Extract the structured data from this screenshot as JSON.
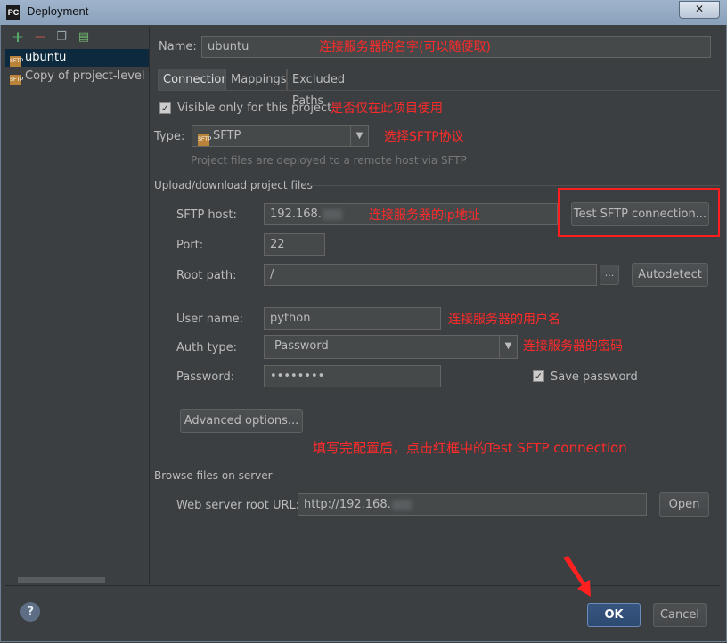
{
  "window": {
    "app_icon": "PC",
    "title": "Deployment",
    "close_symbol": "✕"
  },
  "toolbar": {
    "add_icon": "+",
    "remove_icon": "−",
    "copy_icon": "❐",
    "db_icon": "▤"
  },
  "servers": [
    {
      "label": "ubuntu",
      "badge": "SFTP",
      "selected": true
    },
    {
      "label": "Copy of project-level se",
      "badge": "SFTP",
      "selected": false
    }
  ],
  "name": {
    "label": "Name:",
    "value": "ubuntu",
    "annotation": "连接服务器的名字(可以随便取)"
  },
  "tabs": [
    "Connection",
    "Mappings",
    "Excluded Paths"
  ],
  "visible_only": {
    "label": "Visible only for this project",
    "checked": true,
    "annotation": "是否仅在此项目使用"
  },
  "type": {
    "label": "Type:",
    "value": "SFTP",
    "annotation": "选择SFTP协议",
    "hint": "Project files are deployed to a remote host via SFTP"
  },
  "upload_section": {
    "title": "Upload/download project files"
  },
  "sftp_host": {
    "label": "SFTP host:",
    "value": "192.168.",
    "annotation": "连接服务器的ip地址",
    "test_button": "Test SFTP connection..."
  },
  "port": {
    "label": "Port:",
    "value": "22"
  },
  "root_path": {
    "label": "Root path:",
    "value": "/",
    "browse": "...",
    "autodetect": "Autodetect"
  },
  "user_name": {
    "label": "User name:",
    "value": "python",
    "annotation": "连接服务器的用户名"
  },
  "auth_type": {
    "label": "Auth type:",
    "value": "Password",
    "annotation": "连接服务器的密码"
  },
  "password": {
    "label": "Password:",
    "value": "••••••••",
    "save_label": "Save password",
    "save_checked": true
  },
  "advanced_button": "Advanced options...",
  "bottom_annotation": "填写完配置后，点击红框中的Test SFTP connection",
  "browse_section": {
    "title": "Browse files on server"
  },
  "web_root": {
    "label": "Web server root URL:",
    "value": "http://192.168.",
    "open_button": "Open"
  },
  "footer": {
    "help_symbol": "?",
    "ok_label": "OK",
    "cancel_label": "Cancel"
  }
}
